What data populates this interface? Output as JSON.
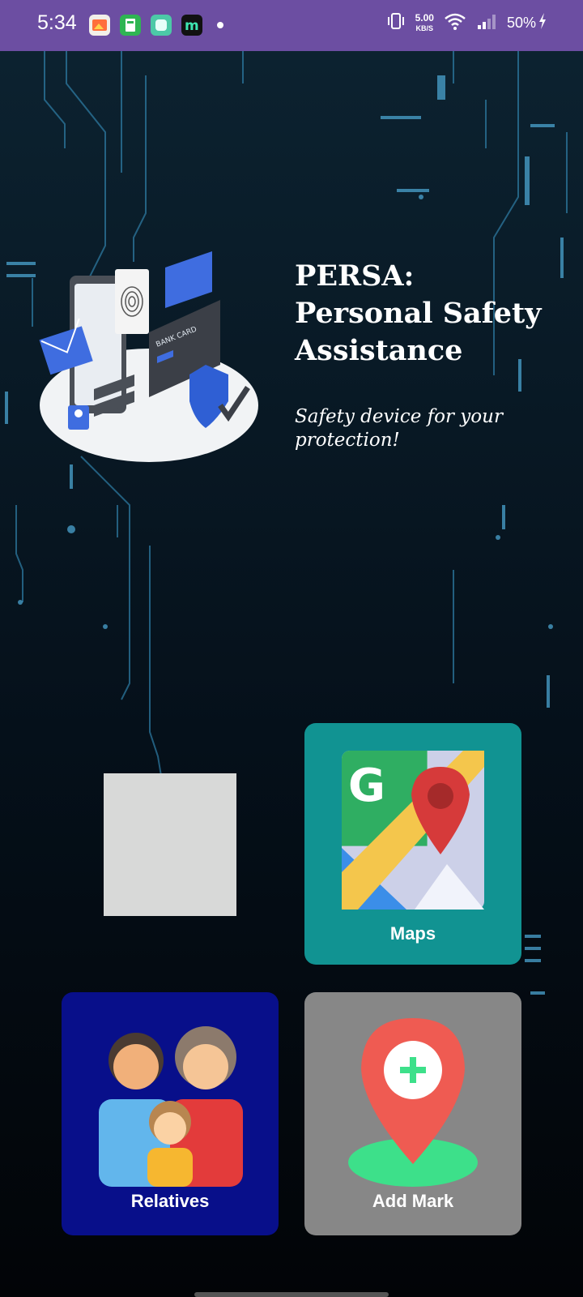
{
  "status_bar": {
    "time": "5:34",
    "net_speed_value": "5.00",
    "net_speed_unit": "KB/S",
    "battery": "50%"
  },
  "header": {
    "title": "PERSA:\nPersonal Safety\nAssistance",
    "tagline": "Safety device for your protection!",
    "illustration_text": "BANK CARD"
  },
  "tiles": {
    "maps_label": "Maps",
    "relatives_label": "Relatives",
    "add_mark_label": "Add Mark"
  },
  "colors": {
    "status_bar": "#6c4ea2",
    "maps_tile": "#119392",
    "relatives_tile": "#080f8a",
    "add_mark_tile": "#878787"
  }
}
